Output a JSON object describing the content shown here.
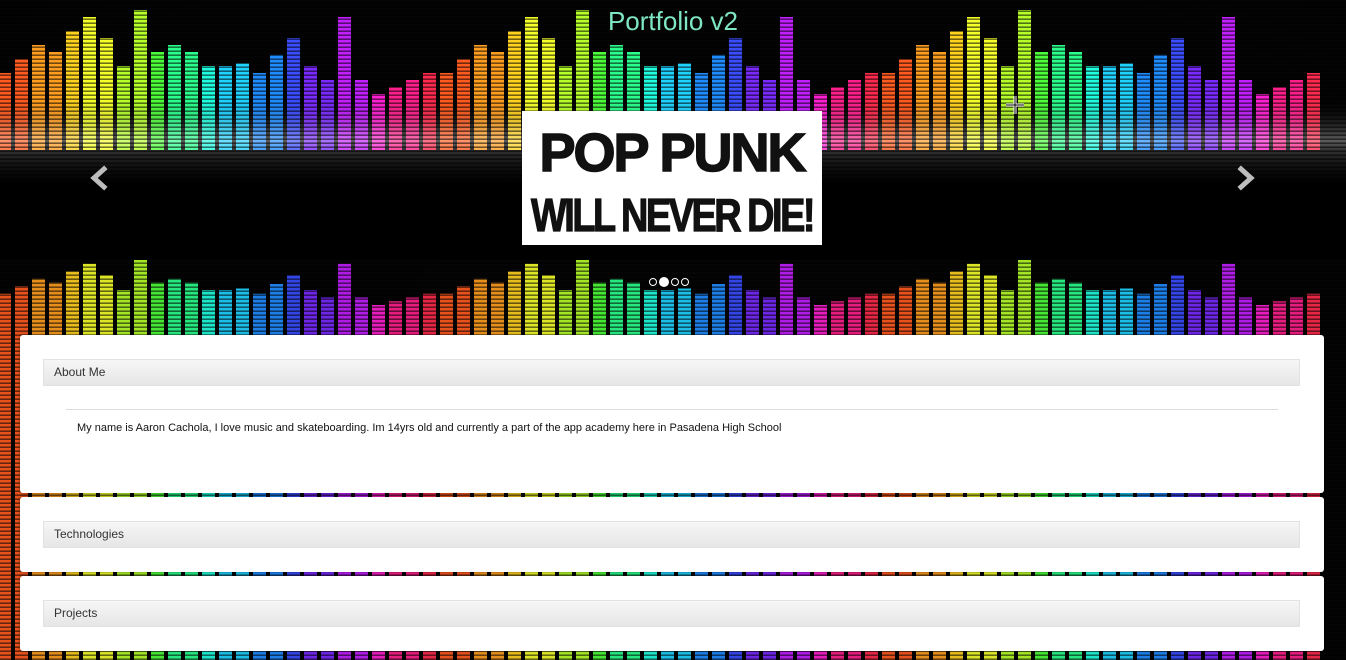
{
  "header": {
    "title": "Portfolio v2"
  },
  "carousel": {
    "image_lines": [
      "POP PUNK",
      "WILL NEVER DIE!"
    ],
    "prev_icon": "chevron-left-icon",
    "next_icon": "chevron-right-icon",
    "slide_count": 4,
    "active_slide": 2
  },
  "panels": {
    "about": {
      "heading": "About Me",
      "body": "My name is Aaron Cachola, I love music and skateboarding. Im 14yrs old and currently a part of the app academy here in Pasadena High School"
    },
    "technologies": {
      "heading": "Technologies"
    },
    "projects": {
      "heading": "Projects"
    }
  },
  "colors": {
    "title": "#7fe6c4",
    "panel_bg": "#ffffff",
    "heading_bg": "#ececec"
  }
}
